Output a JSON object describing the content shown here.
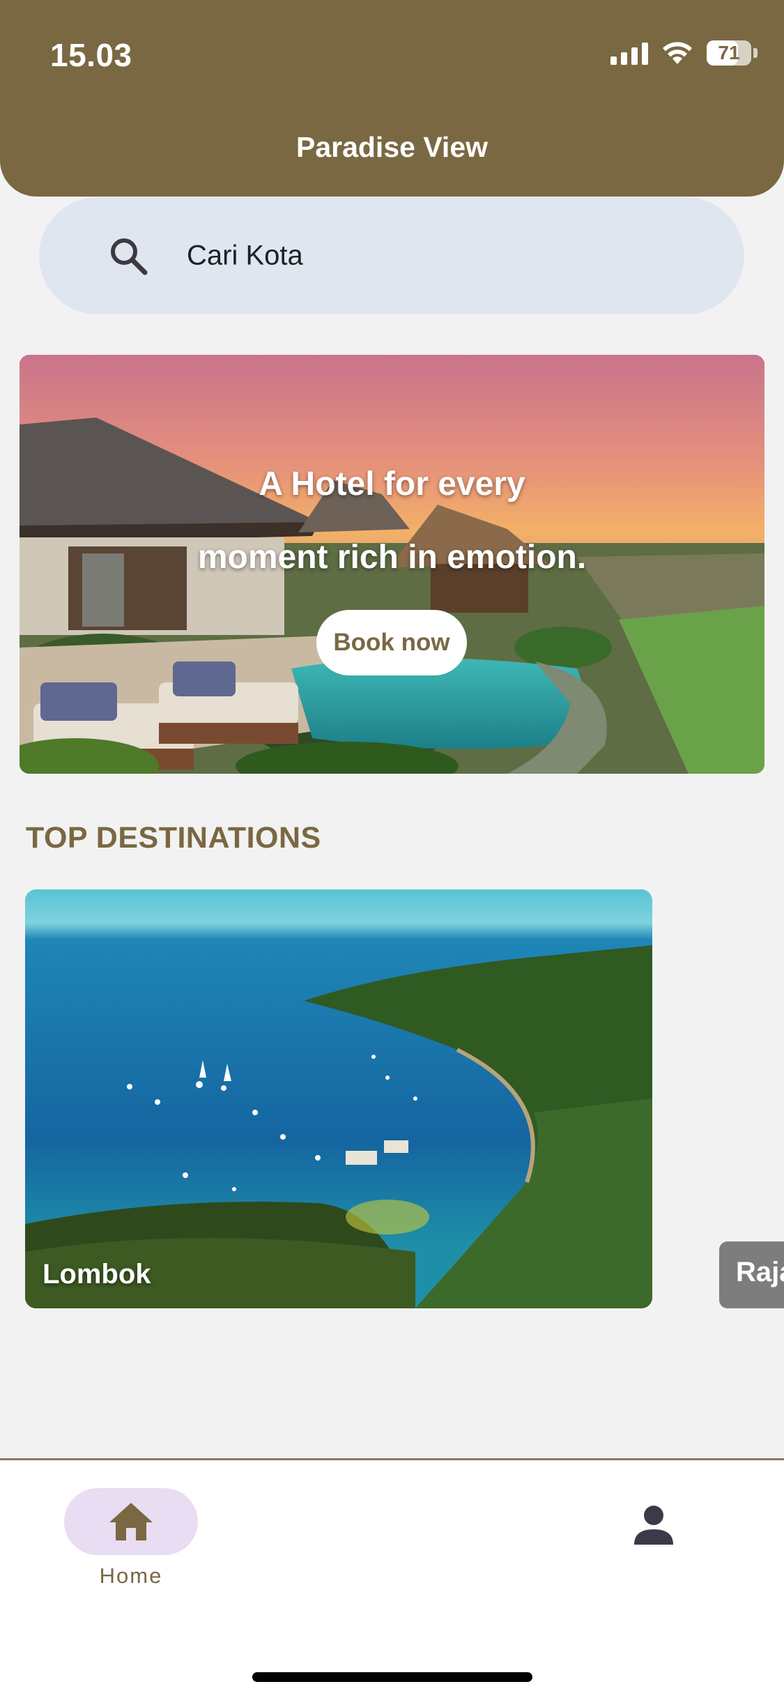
{
  "status_bar": {
    "time": "15.03",
    "battery_percent": "71",
    "signal_icon": "cellular-signal-icon",
    "wifi_icon": "wifi-icon",
    "battery_icon": "battery-icon"
  },
  "header": {
    "title": "Paradise View",
    "background_color": "#7a6842"
  },
  "search": {
    "placeholder": "Cari Kota",
    "icon": "search-icon"
  },
  "hero": {
    "line1": "A Hotel for every",
    "line2": "moment rich in emotion.",
    "cta_label": "Book now",
    "image": "hotel-villa-pool-sunset"
  },
  "top_destinations": {
    "title": "TOP DESTINATIONS",
    "items": [
      {
        "name": "Lombok",
        "image": "coastal-bay-aerial"
      },
      {
        "name": "Raja"
      }
    ]
  },
  "bottom_nav": {
    "items": [
      {
        "label": "Home",
        "icon": "home-icon",
        "active": true
      },
      {
        "label": "",
        "icon": "person-icon",
        "active": false
      }
    ],
    "active_pill_color": "#e8ddf2"
  }
}
